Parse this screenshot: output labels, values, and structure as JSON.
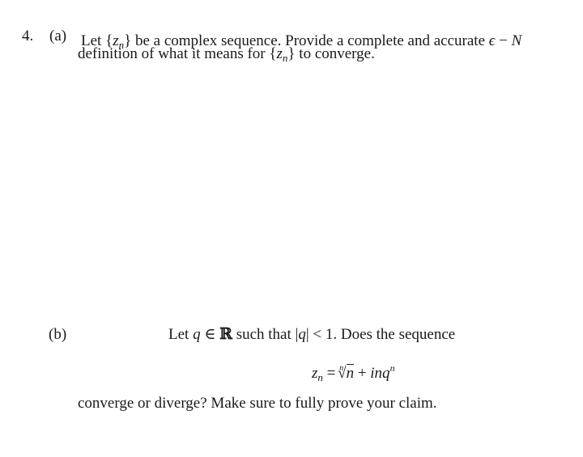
{
  "question": {
    "number": "4.",
    "part_a": {
      "label": "(a)",
      "line1_pre": "Let {",
      "seq_var": "z",
      "seq_sub": "n",
      "line1_mid": "} be a complex sequence. Provide a complete and accurate ",
      "epsilon": "ϵ",
      "dash": " − ",
      "N": "N",
      "line2_pre": "definition of what it means for {",
      "line2_post": "} to converge."
    },
    "part_b": {
      "label": "(b)",
      "line1_pre": "Let ",
      "q": "q",
      "elem": " ∈ ",
      "reals": "ℝ",
      "line1_mid": " such that |",
      "line1_post": "| < 1. Does the sequence",
      "formula": {
        "lhs_var": "z",
        "lhs_sub": "n",
        "equals": " = ",
        "root_index": "n",
        "radical": "√",
        "radicand": "n",
        "plus": " + ",
        "term": "inq",
        "exponent": "n"
      },
      "line2": "converge or diverge? Make sure to fully prove your claim."
    }
  }
}
